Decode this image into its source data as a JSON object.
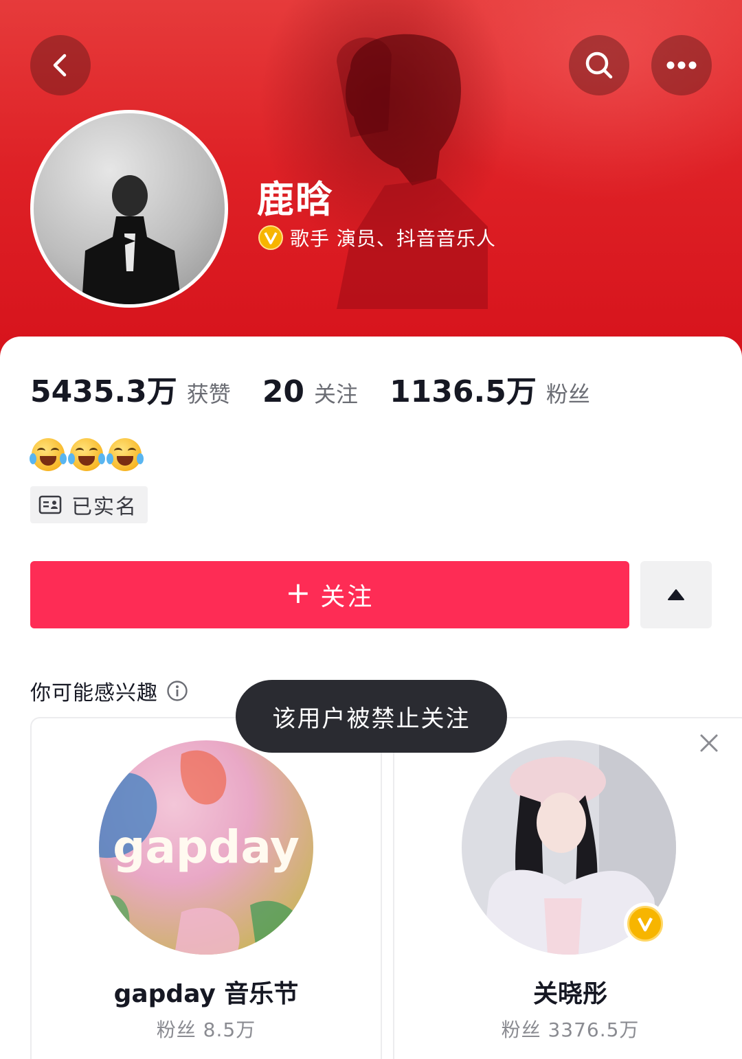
{
  "header": {
    "back_icon": "chevron-left-icon",
    "search_icon": "search-icon",
    "more_icon": "more-dots-icon"
  },
  "profile": {
    "name": "鹿晗",
    "verified_icon": "verified-v-icon",
    "verified_text": "歌手 演员、抖音音乐人",
    "bio_emojis": [
      "😂",
      "😂",
      "😂"
    ],
    "realname_label": "已实名"
  },
  "stats": [
    {
      "value": "5435.3万",
      "label": "获赞"
    },
    {
      "value": "20",
      "label": "关注"
    },
    {
      "value": "1136.5万",
      "label": "粉丝"
    }
  ],
  "actions": {
    "follow_plus": "+",
    "follow_label": "关注",
    "expand_icon": "triangle-up-icon"
  },
  "recommend": {
    "title": "你可能感兴趣",
    "info_icon": "info-icon",
    "cards": [
      {
        "name": "gapday 音乐节",
        "fans": "粉丝 8.5万",
        "logo_text": "gapday"
      },
      {
        "name": "关晓彤",
        "fans": "粉丝 3376.5万",
        "verified_icon": "verified-v-icon"
      }
    ]
  },
  "toast": {
    "text": "该用户被禁止关注"
  },
  "colors": {
    "banner_red": "#de2126",
    "follow_button": "#fe2c55",
    "verified_gold": "#f7b500",
    "toast_bg": "#2a2b31"
  }
}
